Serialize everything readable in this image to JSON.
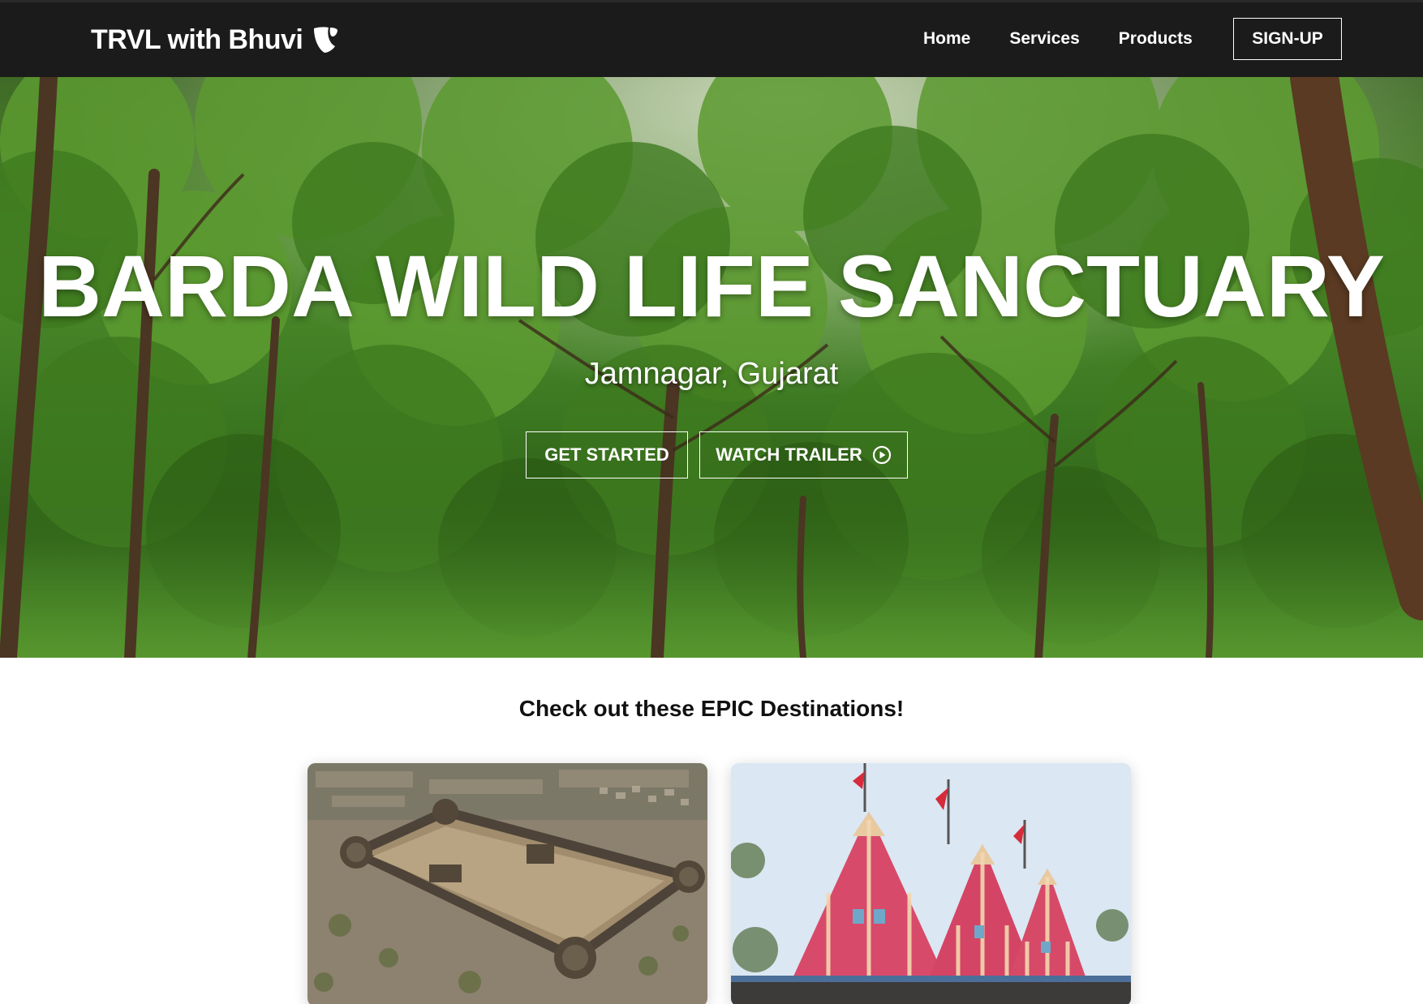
{
  "navbar": {
    "brand": "TRVL with Bhuvi",
    "brand_icon": "typo3-logo-icon",
    "links": [
      "Home",
      "Services",
      "Products"
    ],
    "signup_label": "SIGN-UP",
    "background": "#1c1b1b"
  },
  "hero": {
    "title": "BARDA WILD LIFE SANCTUARY",
    "subtitle": "Jamnagar, Gujarat",
    "get_started_label": "GET STARTED",
    "watch_trailer_label": "WATCH TRAILER",
    "trailer_icon": "play-circle-icon",
    "background_image": "forest"
  },
  "destinations": {
    "heading": "Check out these EPIC Destinations!",
    "cards": [
      {
        "image": "aerial-fort"
      },
      {
        "image": "red-temple-spires"
      }
    ]
  }
}
